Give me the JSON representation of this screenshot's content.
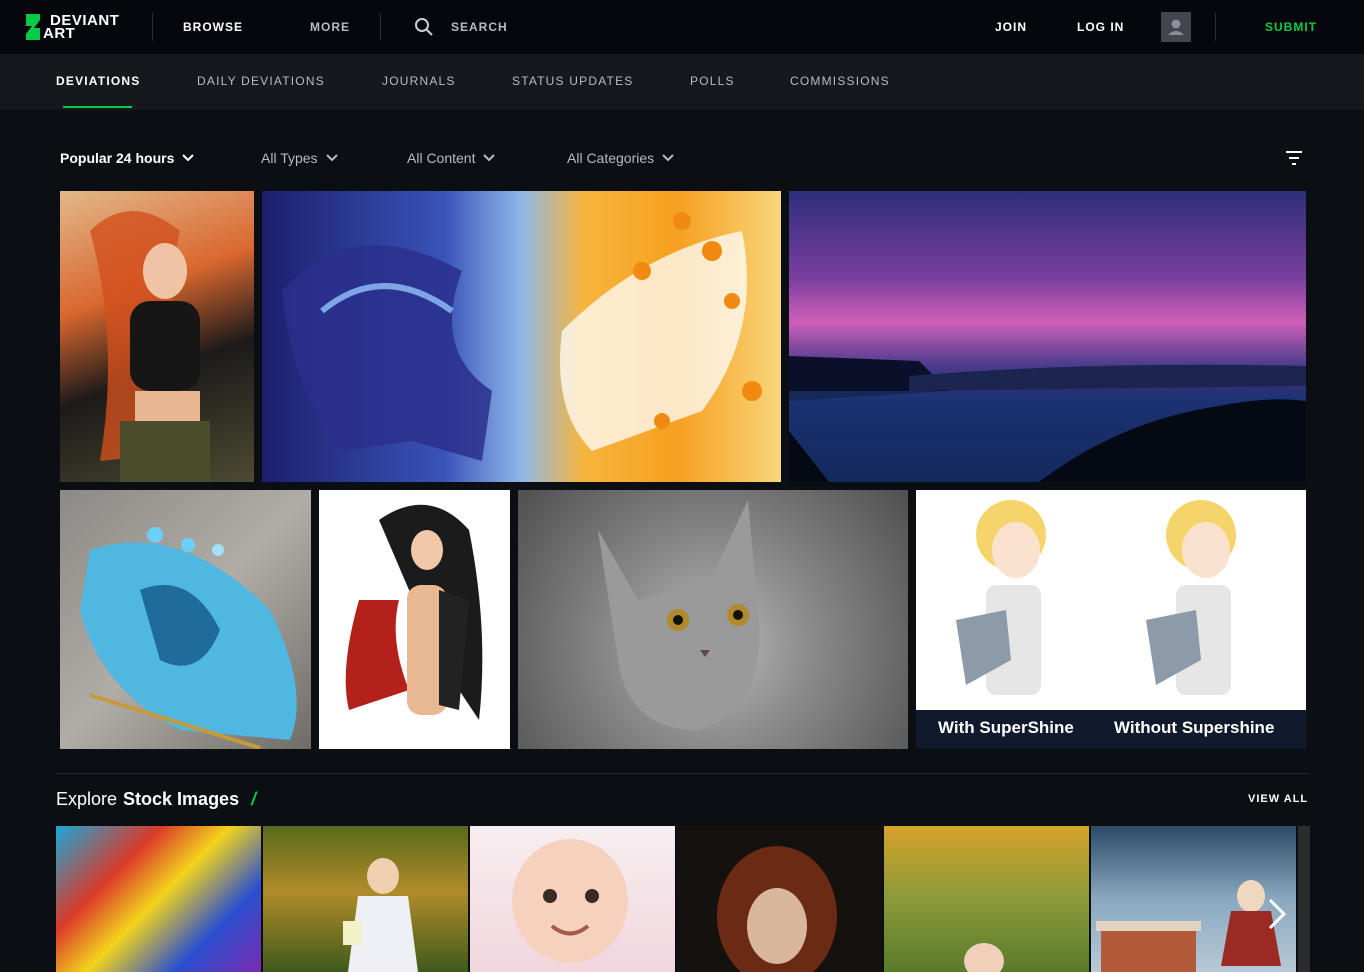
{
  "header": {
    "logo_line1": "DEVIANT",
    "logo_line2": "ART",
    "browse": "BROWSE",
    "more": "MORE",
    "search_label": "SEARCH",
    "join": "JOIN",
    "login": "LOG IN",
    "submit": "SUBMIT"
  },
  "tabs": [
    {
      "label": "DEVIATIONS",
      "active": true
    },
    {
      "label": "DAILY DEVIATIONS",
      "active": false
    },
    {
      "label": "JOURNALS",
      "active": false
    },
    {
      "label": "STATUS UPDATES",
      "active": false
    },
    {
      "label": "POLLS",
      "active": false
    },
    {
      "label": "COMMISSIONS",
      "active": false
    }
  ],
  "filters": {
    "sort": "Popular 24 hours",
    "types": "All Types",
    "content": "All Content",
    "categories": "All Categories"
  },
  "gallery": {
    "row1": [
      {
        "subject": "red-haired heroine illustration"
      },
      {
        "subject": "blue and gold winged horses artwork"
      },
      {
        "subject": "purple sunset over lake landscape"
      }
    ],
    "row2": [
      {
        "subject": "blue dragon carved agate"
      },
      {
        "subject": "hooded red cape figure illustration"
      },
      {
        "subject": "grey kitten photo"
      },
      {
        "subject": "anime comparison render",
        "caption_left": "With SuperShine",
        "caption_right": "Without Supershine"
      }
    ]
  },
  "stock": {
    "heading_prefix": "Explore",
    "heading_bold": "Stock Images",
    "view_all": "VIEW ALL"
  },
  "colors": {
    "accent": "#05cc47",
    "background": "#0b0e13",
    "header": "#06070d",
    "subnav": "#15191e"
  }
}
